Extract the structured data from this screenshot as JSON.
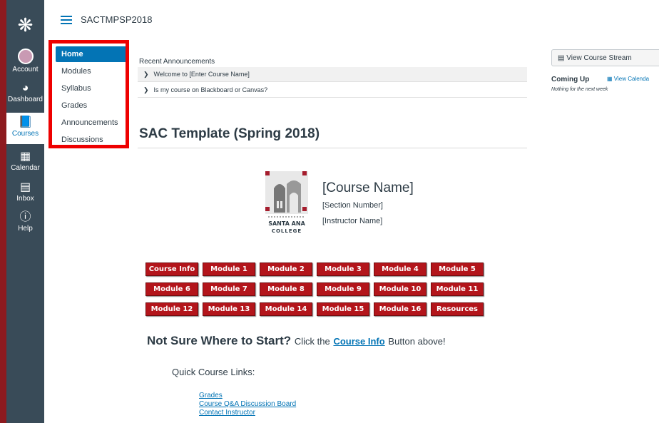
{
  "global_nav": {
    "items": [
      {
        "label": "Account",
        "icon": "account-avatar"
      },
      {
        "label": "Dashboard",
        "icon": "dashboard-icon"
      },
      {
        "label": "Courses",
        "icon": "courses-icon"
      },
      {
        "label": "Calendar",
        "icon": "calendar-icon"
      },
      {
        "label": "Inbox",
        "icon": "inbox-icon"
      },
      {
        "label": "Help",
        "icon": "help-icon"
      }
    ],
    "active": "Courses"
  },
  "breadcrumb": "SACTMPSP2018",
  "course_nav": {
    "items": [
      "Home",
      "Modules",
      "Syllabus",
      "Grades",
      "Announcements",
      "Discussions"
    ],
    "active": "Home"
  },
  "announcements": {
    "title": "Recent Announcements",
    "items": [
      "Welcome to [Enter Course Name]",
      "Is my course on Blackboard or Canvas?"
    ]
  },
  "page_title": "SAC Template (Spring 2018)",
  "course_header": {
    "college_name_line1": "SANTA ANA",
    "college_name_line2": "COLLEGE",
    "course_name": "[Course Name]",
    "section_number": "[Section Number]",
    "instructor_name": "[Instructor Name]"
  },
  "module_buttons": [
    [
      "Course Info",
      "Module 1",
      "Module 2",
      "Module 3",
      "Module 4",
      "Module 5"
    ],
    [
      "Module 6",
      "Module 7",
      "Module 8",
      "Module 9",
      "Module 10",
      "Module 11"
    ],
    [
      "Module 12",
      "Module 13",
      "Module 14",
      "Module 15",
      "Module 16",
      "Resources"
    ]
  ],
  "colors": {
    "module_button": "#b3151b",
    "nav_bg": "#394b58",
    "accent": "#0374b5",
    "highlight_box": "#ee0000"
  },
  "start_prompt": {
    "heading": "Not Sure Where to Start?",
    "prefix": "Click the",
    "link": "Course Info",
    "suffix": "Button above!"
  },
  "quick_links": {
    "title": "Quick Course Links:",
    "links": [
      "Grades",
      "Course Q&A Discussion Board",
      "Contact Instructor"
    ]
  },
  "sidebar": {
    "stream_button": "View Course Stream",
    "coming_up": "Coming Up",
    "view_calendar": "View Calenda",
    "nothing": "Nothing for the next week"
  }
}
